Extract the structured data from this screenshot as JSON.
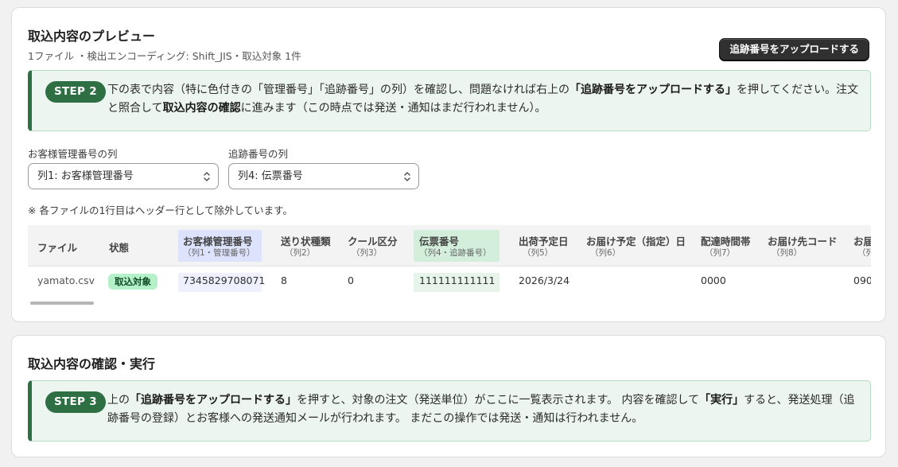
{
  "preview": {
    "title": "取込内容のプレビュー",
    "subtitle": "1ファイル ・検出エンコーディング: Shift_JIS・取込対象 1件",
    "upload_button": "追跡番号をアップロードする",
    "step_badge": "STEP 2",
    "step_text": {
      "p1": "下の表で内容（特に色付きの「管理番号」「追跡番号」の列）を確認し、問題なければ右上の",
      "b1": "「追跡番号をアップロードする」",
      "p2": "を押してください。注文と照合して",
      "b2": "取込内容の確認",
      "p3": "に進みます（この時点では発送・通知はまだ行われません）。"
    },
    "customer_col_label": "お客様管理番号の列",
    "customer_col_value": "列1: お客様管理番号",
    "tracking_col_label": "追跡番号の列",
    "tracking_col_value": "列4: 伝票番号",
    "note": "※ 各ファイルの1行目はヘッダー行として除外しています。"
  },
  "table": {
    "headers": {
      "file": "ファイル",
      "status": "状態",
      "customer_no": "お客様管理番号",
      "customer_no_sub": "（列1・管理番号）",
      "slip_type": "送り状種類",
      "slip_type_sub": "（列2）",
      "cool": "クール区分",
      "cool_sub": "（列3）",
      "tracking": "伝票番号",
      "tracking_sub": "（列4・追跡番号）",
      "ship_date": "出荷予定日",
      "ship_date_sub": "（列5）",
      "delivery_date": "お届け予定（指定）日",
      "delivery_date_sub": "（列6）",
      "time_slot": "配達時間帯",
      "time_slot_sub": "（列7）",
      "dest_code": "お届け先コード",
      "dest_code_sub": "（列8）",
      "next_col": "お届",
      "next_col_sub": "（列"
    },
    "row": {
      "file": "yamato.csv",
      "status": "取込対象",
      "customer_no": "7345829708071",
      "slip_type": "8",
      "cool": "0",
      "tracking": "111111111111",
      "ship_date": "2026/3/24",
      "delivery_date": "",
      "time_slot": "0000",
      "dest_code": "",
      "next_col": "090"
    }
  },
  "confirm": {
    "title": "取込内容の確認・実行",
    "step_badge": "STEP 3",
    "step_text": {
      "p1": "上の",
      "b1": "「追跡番号をアップロードする」",
      "p2": "を押すと、対象の注文（発送単位）がここに一覧表示されます。 内容を確認して",
      "b2": "「実行」",
      "p3": "すると、発送処理（追跡番号の登録）とお客様への発送通知メールが行われます。 まだこの操作では発送・通知は行われません。"
    }
  },
  "colors": {
    "customer_highlight": "#dde3fc",
    "tracking_highlight": "#d3eedb",
    "step_accent": "#2e6f44",
    "status_badge_bg": "#b4f1c8"
  }
}
